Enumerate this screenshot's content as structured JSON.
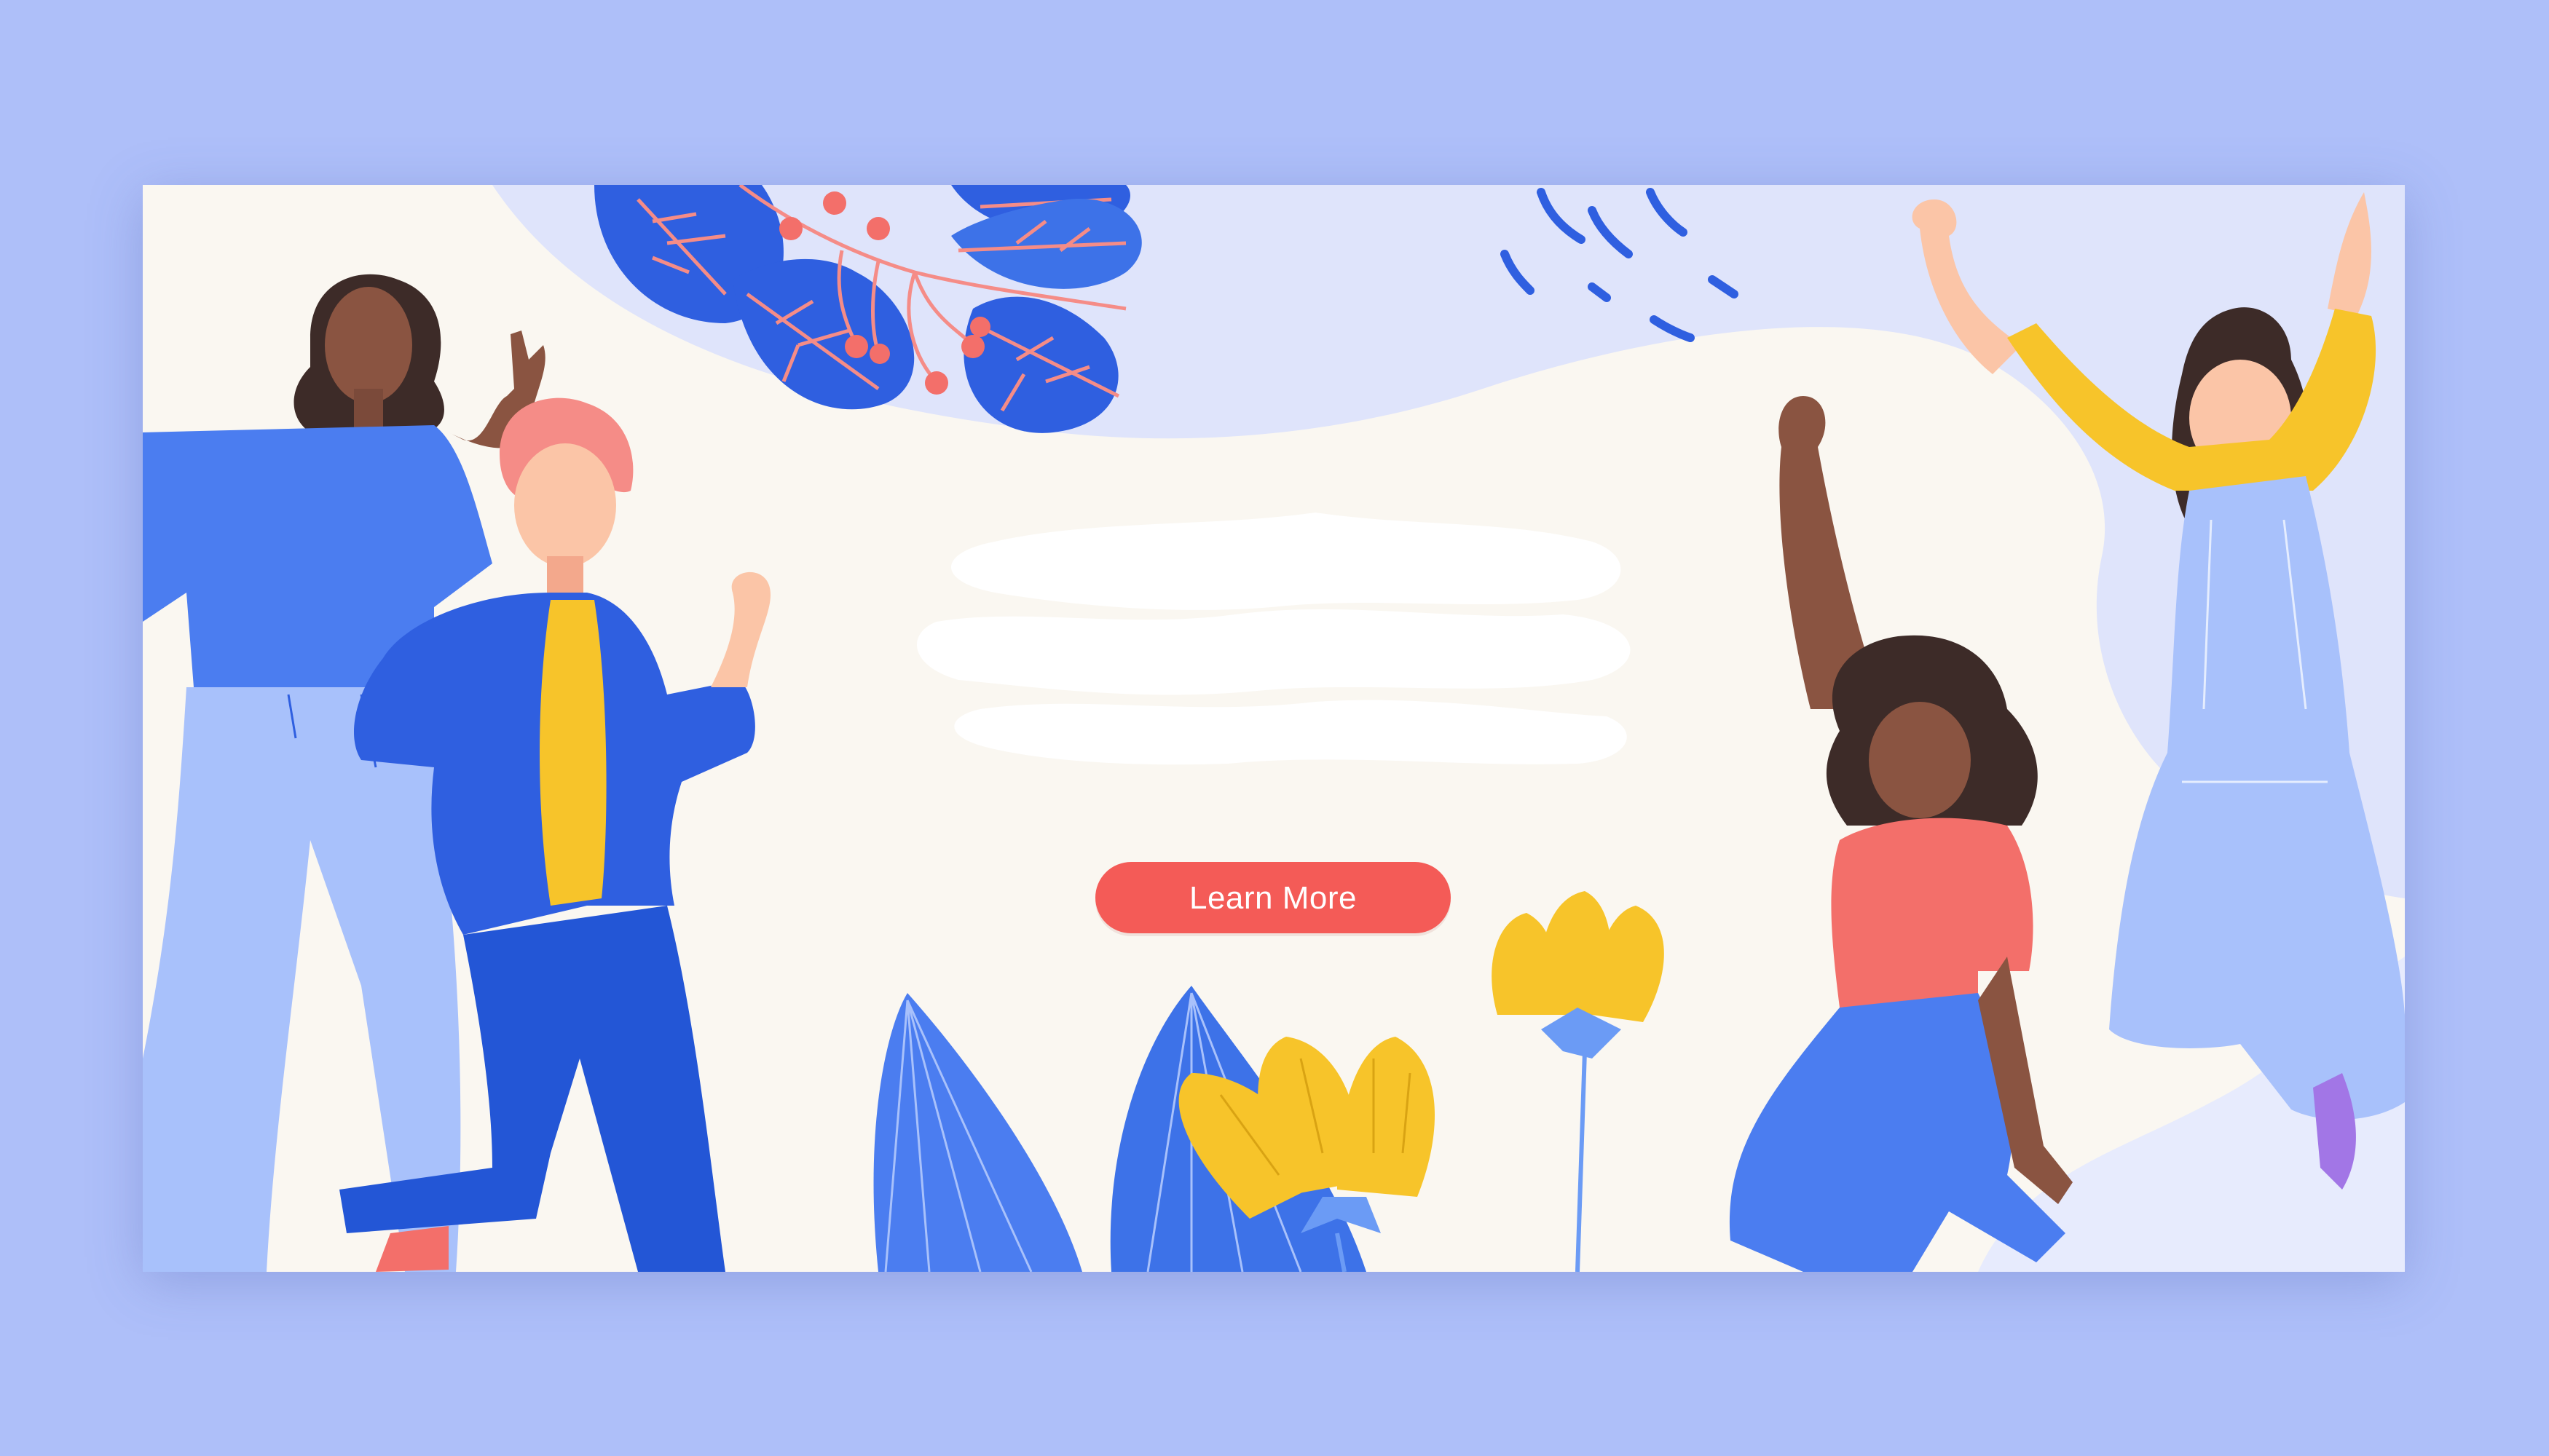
{
  "banner": {
    "cta_label": "Learn More"
  },
  "colors": {
    "page_background": "#aebff9",
    "banner_background": "#faf7f1",
    "lavender_blob": "#dfe4fb",
    "primary_blue": "#2f5fe0",
    "light_blue": "#a8c1fb",
    "yellow": "#f7c42a",
    "coral": "#f36f6a",
    "cta_red": "#f45b57"
  },
  "icons": [
    "leaf-cluster-icon",
    "berry-branch-icon",
    "sparkle-dash-icon",
    "plant-leaves-icon",
    "yellow-flower-icon"
  ]
}
